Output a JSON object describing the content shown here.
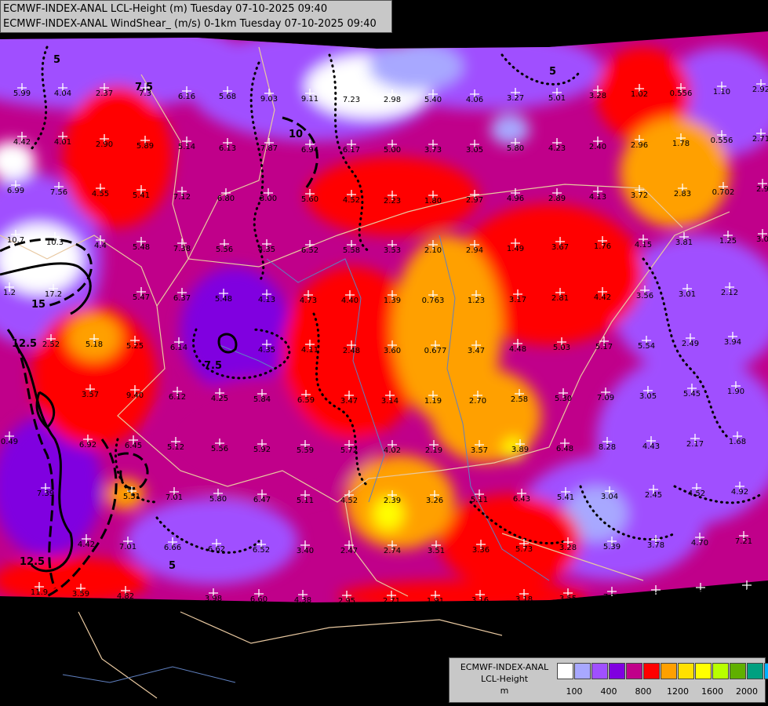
{
  "header": {
    "line1": "ECMWF-INDEX-ANAL LCL-Height (m) Tuesday 07-10-2025 09:40",
    "line2": "ECMWF-INDEX-ANAL WindShear_ (m/s) 0-1km Tuesday 07-10-2025 09:40"
  },
  "legend": {
    "title_lines": [
      "ECMWF-INDEX-ANAL",
      "LCL-Height",
      "m"
    ],
    "colors": [
      "#ffffff",
      "#a8a8ff",
      "#a050ff",
      "#8000e0",
      "#c0008a",
      "#ff0000",
      "#ffa000",
      "#ffe000",
      "#ffff00",
      "#b8ff00",
      "#60b000",
      "#00a080",
      "#00b0ff"
    ],
    "ticks": [
      "100",
      "400",
      "800",
      "1200",
      "1600",
      "2000"
    ]
  },
  "contour_labels": [
    "5",
    "7.5",
    "10",
    "12.5",
    "15"
  ],
  "values": [
    [
      "5.99",
      28,
      118
    ],
    [
      "4.04",
      80,
      118
    ],
    [
      "2.37",
      133,
      118
    ],
    [
      "7.3",
      185,
      118
    ],
    [
      "6.16",
      238,
      122
    ],
    [
      "5.68",
      290,
      122
    ],
    [
      "9.03",
      343,
      125
    ],
    [
      "9.11",
      395,
      125
    ],
    [
      "7.23",
      448,
      126
    ],
    [
      "2.98",
      500,
      126
    ],
    [
      "5.40",
      552,
      126
    ],
    [
      "4.06",
      605,
      126
    ],
    [
      "3.27",
      657,
      124
    ],
    [
      "5.01",
      710,
      124
    ],
    [
      "3.28",
      762,
      121
    ],
    [
      "1.02",
      815,
      119
    ],
    [
      "0.556",
      868,
      118
    ],
    [
      "1.10",
      920,
      116
    ],
    [
      "2.92",
      970,
      113
    ],
    [
      "4.42",
      28,
      180
    ],
    [
      "4.01",
      80,
      180
    ],
    [
      "2.90",
      133,
      183
    ],
    [
      "5.89",
      185,
      185
    ],
    [
      "5.14",
      238,
      186
    ],
    [
      "6.13",
      290,
      188
    ],
    [
      "7.87",
      343,
      188
    ],
    [
      "6.94",
      395,
      190
    ],
    [
      "6.17",
      448,
      190
    ],
    [
      "5.00",
      500,
      190
    ],
    [
      "3.73",
      552,
      190
    ],
    [
      "3.05",
      605,
      190
    ],
    [
      "5.80",
      657,
      188
    ],
    [
      "4.23",
      710,
      188
    ],
    [
      "2.40",
      762,
      186
    ],
    [
      "2.96",
      815,
      184
    ],
    [
      "1.78",
      868,
      182
    ],
    [
      "0.556",
      920,
      178
    ],
    [
      "2.71",
      970,
      176
    ],
    [
      "6.99",
      20,
      242
    ],
    [
      "7.56",
      75,
      244
    ],
    [
      "4.55",
      128,
      246
    ],
    [
      "5.41",
      180,
      248
    ],
    [
      "7.12",
      232,
      250
    ],
    [
      "6.80",
      288,
      252
    ],
    [
      "3.00",
      342,
      252
    ],
    [
      "5.60",
      395,
      253
    ],
    [
      "4.52",
      448,
      254
    ],
    [
      "2.23",
      500,
      255
    ],
    [
      "1.80",
      552,
      255
    ],
    [
      "2.97",
      605,
      254
    ],
    [
      "4.96",
      657,
      252
    ],
    [
      "2.89",
      710,
      252
    ],
    [
      "4.13",
      762,
      250
    ],
    [
      "3.72",
      815,
      248
    ],
    [
      "2.83",
      870,
      246
    ],
    [
      "0.702",
      922,
      244
    ],
    [
      "2.9",
      972,
      240
    ],
    [
      "10.7",
      20,
      305
    ],
    [
      "10.3",
      70,
      308
    ],
    [
      "4.4",
      128,
      312
    ],
    [
      "5.48",
      180,
      314
    ],
    [
      "7.38",
      232,
      316
    ],
    [
      "5.56",
      286,
      317
    ],
    [
      "4.35",
      340,
      317
    ],
    [
      "6.52",
      395,
      318
    ],
    [
      "5.58",
      448,
      318
    ],
    [
      "3.53",
      500,
      318
    ],
    [
      "2.10",
      552,
      318
    ],
    [
      "2.94",
      605,
      318
    ],
    [
      "1.49",
      657,
      316
    ],
    [
      "3.67",
      714,
      314
    ],
    [
      "1.76",
      768,
      313
    ],
    [
      "4.15",
      820,
      311
    ],
    [
      "3.81",
      872,
      308
    ],
    [
      "1.25",
      928,
      306
    ],
    [
      "3.0",
      972,
      304
    ],
    [
      "1.2",
      12,
      372
    ],
    [
      "17.2",
      68,
      374
    ],
    [
      "5.47",
      180,
      378
    ],
    [
      "6.37",
      232,
      379
    ],
    [
      "5.48",
      285,
      380
    ],
    [
      "4.13",
      340,
      381
    ],
    [
      "4.73",
      393,
      382
    ],
    [
      "4.40",
      446,
      382
    ],
    [
      "1.39",
      500,
      382
    ],
    [
      "0.763",
      552,
      382
    ],
    [
      "1.23",
      607,
      382
    ],
    [
      "3.17",
      660,
      381
    ],
    [
      "2.81",
      714,
      379
    ],
    [
      "4.42",
      768,
      378
    ],
    [
      "3.56",
      822,
      376
    ],
    [
      "3.01",
      876,
      374
    ],
    [
      "2.12",
      930,
      372
    ],
    [
      "2.52",
      65,
      438
    ],
    [
      "5.18",
      120,
      438
    ],
    [
      "5.25",
      172,
      440
    ],
    [
      "6.14",
      228,
      442
    ],
    [
      "4.35",
      340,
      445
    ],
    [
      "4.11",
      395,
      445
    ],
    [
      "2.48",
      448,
      446
    ],
    [
      "3.60",
      500,
      446
    ],
    [
      "0.677",
      555,
      446
    ],
    [
      "3.47",
      607,
      446
    ],
    [
      "4.48",
      660,
      444
    ],
    [
      "5.03",
      716,
      442
    ],
    [
      "5.17",
      770,
      441
    ],
    [
      "5.54",
      824,
      440
    ],
    [
      "2.49",
      880,
      437
    ],
    [
      "3.94",
      934,
      435
    ],
    [
      "3.57",
      115,
      502
    ],
    [
      "9.40",
      172,
      503
    ],
    [
      "6.12",
      226,
      505
    ],
    [
      "4.25",
      280,
      507
    ],
    [
      "5.84",
      334,
      508
    ],
    [
      "6.59",
      390,
      509
    ],
    [
      "3.47",
      445,
      510
    ],
    [
      "3.14",
      497,
      510
    ],
    [
      "1.19",
      552,
      510
    ],
    [
      "2.70",
      609,
      510
    ],
    [
      "2.58",
      662,
      508
    ],
    [
      "5.30",
      718,
      507
    ],
    [
      "7.09",
      772,
      506
    ],
    [
      "3.05",
      826,
      504
    ],
    [
      "5.45",
      882,
      501
    ],
    [
      "1.90",
      938,
      498
    ],
    [
      "0.49",
      12,
      562
    ],
    [
      "6.92",
      112,
      566
    ],
    [
      "6.45",
      170,
      567
    ],
    [
      "5.12",
      224,
      569
    ],
    [
      "5.56",
      280,
      571
    ],
    [
      "5.92",
      334,
      572
    ],
    [
      "5.59",
      389,
      573
    ],
    [
      "5.72",
      445,
      573
    ],
    [
      "4.02",
      500,
      573
    ],
    [
      "2.19",
      553,
      573
    ],
    [
      "3.57",
      611,
      573
    ],
    [
      "3.89",
      663,
      572
    ],
    [
      "6.48",
      720,
      571
    ],
    [
      "8.28",
      774,
      569
    ],
    [
      "4.43",
      830,
      568
    ],
    [
      "2.17",
      886,
      565
    ],
    [
      "1.68",
      940,
      562
    ],
    [
      "7.39",
      58,
      628
    ],
    [
      "5.51",
      168,
      632
    ],
    [
      "7.01",
      222,
      633
    ],
    [
      "5.80",
      278,
      635
    ],
    [
      "6.47",
      334,
      636
    ],
    [
      "5.11",
      389,
      637
    ],
    [
      "4.52",
      445,
      637
    ],
    [
      "2.39",
      500,
      637
    ],
    [
      "3.26",
      554,
      637
    ],
    [
      "5.11",
      611,
      636
    ],
    [
      "6.43",
      665,
      635
    ],
    [
      "5.41",
      721,
      633
    ],
    [
      "3.04",
      777,
      632
    ],
    [
      "2.45",
      833,
      630
    ],
    [
      "4.52",
      888,
      628
    ],
    [
      "4.92",
      943,
      626
    ],
    [
      "4.42",
      110,
      693
    ],
    [
      "7.01",
      163,
      696
    ],
    [
      "6.66",
      220,
      697
    ],
    [
      "6.62",
      276,
      699
    ],
    [
      "6.52",
      333,
      700
    ],
    [
      "3.40",
      389,
      701
    ],
    [
      "2.47",
      445,
      701
    ],
    [
      "2.74",
      500,
      701
    ],
    [
      "3.51",
      556,
      701
    ],
    [
      "3.36",
      613,
      700
    ],
    [
      "5.73",
      668,
      699
    ],
    [
      "3.28",
      724,
      697
    ],
    [
      "5.39",
      780,
      696
    ],
    [
      "3.78",
      836,
      694
    ],
    [
      "4.70",
      892,
      691
    ],
    [
      "7.21",
      948,
      689
    ],
    [
      "11.9",
      50,
      754
    ],
    [
      "3.59",
      103,
      756
    ],
    [
      "4.82",
      160,
      759
    ],
    [
      "3.98",
      272,
      762
    ],
    [
      "6.60",
      330,
      763
    ],
    [
      "4.38",
      386,
      764
    ],
    [
      "2.95",
      442,
      765
    ],
    [
      "2.71",
      499,
      765
    ],
    [
      "1.91",
      555,
      765
    ],
    [
      "3.16",
      612,
      764
    ],
    [
      "3.18",
      668,
      763
    ],
    [
      "3.55",
      724,
      762
    ],
    [
      "7.13",
      780,
      760
    ],
    [
      "5.25",
      836,
      758
    ],
    [
      "4.51",
      893,
      755
    ],
    [
      "2.40",
      952,
      752
    ]
  ]
}
